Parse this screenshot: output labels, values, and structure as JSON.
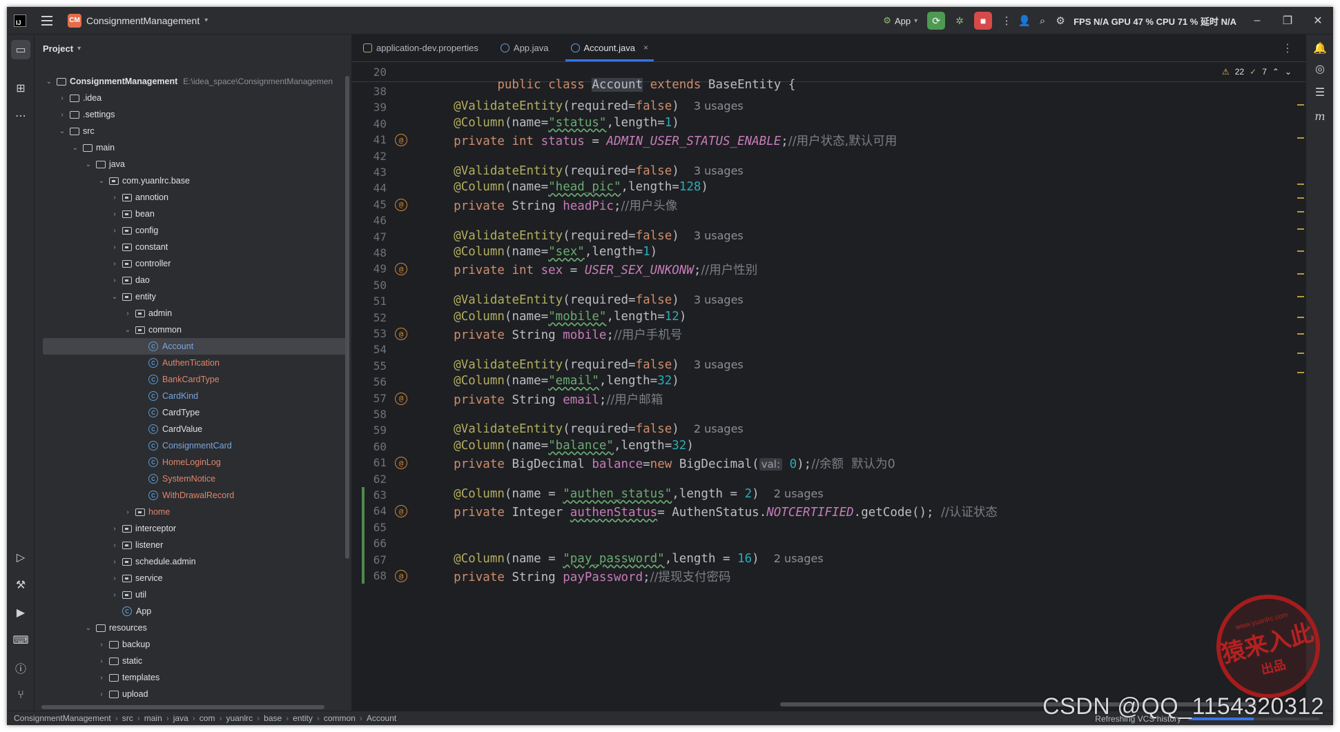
{
  "titlebar": {
    "project_badge": "CM",
    "project_name": "ConsignmentManagement",
    "run_config": "App",
    "stats_fps": "FPS",
    "stats_na1": "N/A",
    "stats_gpu": "GPU",
    "stats_gpu_val": "47 %",
    "stats_cpu": "CPU",
    "stats_cpu_val": "71 %",
    "stats_latency": "延时",
    "stats_na2": "N/A"
  },
  "project_panel": {
    "title": "Project",
    "root_name": "ConsignmentManagement",
    "root_path": "E:\\idea_space\\ConsignmentManagemen",
    "tree": [
      {
        "label": ".idea",
        "depth": 1,
        "type": "folder",
        "expanded": false
      },
      {
        "label": ".settings",
        "depth": 1,
        "type": "folder",
        "expanded": false
      },
      {
        "label": "src",
        "depth": 1,
        "type": "folder",
        "expanded": true
      },
      {
        "label": "main",
        "depth": 2,
        "type": "folder",
        "expanded": true
      },
      {
        "label": "java",
        "depth": 3,
        "type": "folder",
        "expanded": true
      },
      {
        "label": "com.yuanlrc.base",
        "depth": 4,
        "type": "pkg",
        "expanded": true
      },
      {
        "label": "annotion",
        "depth": 5,
        "type": "pkg",
        "expanded": false
      },
      {
        "label": "bean",
        "depth": 5,
        "type": "pkg",
        "expanded": false
      },
      {
        "label": "config",
        "depth": 5,
        "type": "pkg",
        "expanded": false
      },
      {
        "label": "constant",
        "depth": 5,
        "type": "pkg",
        "expanded": false
      },
      {
        "label": "controller",
        "depth": 5,
        "type": "pkg",
        "expanded": false
      },
      {
        "label": "dao",
        "depth": 5,
        "type": "pkg",
        "expanded": false
      },
      {
        "label": "entity",
        "depth": 5,
        "type": "pkg",
        "expanded": true
      },
      {
        "label": "admin",
        "depth": 6,
        "type": "pkg",
        "expanded": false
      },
      {
        "label": "common",
        "depth": 6,
        "type": "pkg",
        "expanded": true
      },
      {
        "label": "Account",
        "depth": 7,
        "type": "class",
        "color": "class",
        "selected": true
      },
      {
        "label": "AuthenTication",
        "depth": 7,
        "type": "class",
        "color": "red"
      },
      {
        "label": "BankCardType",
        "depth": 7,
        "type": "class",
        "color": "red"
      },
      {
        "label": "CardKind",
        "depth": 7,
        "type": "class",
        "color": "class"
      },
      {
        "label": "CardType",
        "depth": 7,
        "type": "class",
        "color": "plain"
      },
      {
        "label": "CardValue",
        "depth": 7,
        "type": "class",
        "color": "plain"
      },
      {
        "label": "ConsignmentCard",
        "depth": 7,
        "type": "class",
        "color": "class"
      },
      {
        "label": "HomeLoginLog",
        "depth": 7,
        "type": "class",
        "color": "red"
      },
      {
        "label": "SystemNotice",
        "depth": 7,
        "type": "class",
        "color": "red"
      },
      {
        "label": "WithDrawalRecord",
        "depth": 7,
        "type": "class",
        "color": "red"
      },
      {
        "label": "home",
        "depth": 6,
        "type": "pkg",
        "expanded": false,
        "color": "red"
      },
      {
        "label": "interceptor",
        "depth": 5,
        "type": "pkg",
        "expanded": false
      },
      {
        "label": "listener",
        "depth": 5,
        "type": "pkg",
        "expanded": false
      },
      {
        "label": "schedule.admin",
        "depth": 5,
        "type": "pkg",
        "expanded": false
      },
      {
        "label": "service",
        "depth": 5,
        "type": "pkg",
        "expanded": false
      },
      {
        "label": "util",
        "depth": 5,
        "type": "pkg",
        "expanded": false
      },
      {
        "label": "App",
        "depth": 5,
        "type": "app",
        "color": "plain"
      },
      {
        "label": "resources",
        "depth": 3,
        "type": "folder",
        "expanded": true
      },
      {
        "label": "backup",
        "depth": 4,
        "type": "folder",
        "expanded": false
      },
      {
        "label": "static",
        "depth": 4,
        "type": "folder",
        "expanded": false
      },
      {
        "label": "templates",
        "depth": 4,
        "type": "folder",
        "expanded": false
      },
      {
        "label": "upload",
        "depth": 4,
        "type": "folder",
        "expanded": false
      }
    ]
  },
  "tabs": [
    {
      "label": "application-dev.properties",
      "active": false,
      "icon": "properties-file-icon"
    },
    {
      "label": "App.java",
      "active": false,
      "icon": "java-app-icon"
    },
    {
      "label": "Account.java",
      "active": true,
      "icon": "java-class-icon",
      "close": "×"
    }
  ],
  "inspections": {
    "warnings": "22",
    "checks": "7"
  },
  "editor": {
    "sticky": {
      "num": "20",
      "text": "public class Account extends BaseEntity {"
    },
    "lines": [
      {
        "n": "38"
      },
      {
        "n": "39",
        "a": "required=",
        "b": "false",
        "u": "3 usages"
      },
      {
        "n": "40",
        "col": "status",
        "len": "1"
      },
      {
        "n": "41",
        "type": "int",
        "field": "status",
        "init": "ADMIN_USER_STATUS_ENABLE",
        "cmt": "//用户状态,默认可用"
      },
      {
        "n": "42"
      },
      {
        "n": "43",
        "u": "3 usages"
      },
      {
        "n": "44",
        "col": "head_pic",
        "len": "128"
      },
      {
        "n": "45",
        "type": "String",
        "field": "headPic",
        "cmt": "//用户头像"
      },
      {
        "n": "46"
      },
      {
        "n": "47",
        "u": "3 usages"
      },
      {
        "n": "48",
        "col": "sex",
        "len": "1"
      },
      {
        "n": "49",
        "type": "int",
        "field": "sex",
        "init": "USER_SEX_UNKONW",
        "cmt": "//用户性别"
      },
      {
        "n": "50"
      },
      {
        "n": "51",
        "u": "3 usages"
      },
      {
        "n": "52",
        "col": "mobile",
        "len": "12"
      },
      {
        "n": "53",
        "type": "String",
        "field": "mobile",
        "cmt": "//用户手机号"
      },
      {
        "n": "54"
      },
      {
        "n": "55",
        "u": "3 usages"
      },
      {
        "n": "56",
        "col": "email",
        "len": "32"
      },
      {
        "n": "57",
        "type": "String",
        "field": "email",
        "cmt": "//用户邮箱"
      },
      {
        "n": "58"
      },
      {
        "n": "59",
        "u": "2 usages"
      },
      {
        "n": "60",
        "col": "balance",
        "len": "32"
      },
      {
        "n": "61",
        "hint": "val:",
        "cmt": "//余额  默认为0"
      },
      {
        "n": "62"
      },
      {
        "n": "63",
        "col": "authen_status",
        "len": "2",
        "u": "2 usages"
      },
      {
        "n": "64",
        "cmt": "//认证状态"
      },
      {
        "n": "65"
      },
      {
        "n": "66"
      },
      {
        "n": "67",
        "col": "pay_password",
        "len": "16",
        "u": "2 usages"
      },
      {
        "n": "68",
        "cmt": "//提现支付密码"
      }
    ]
  },
  "statusbar": {
    "crumbs": [
      "ConsignmentManagement",
      "src",
      "main",
      "java",
      "com",
      "yuanlrc",
      "base",
      "entity",
      "common",
      "Account"
    ],
    "task": "Refreshing VCS history",
    "progress": 0.5
  },
  "watermark": {
    "csdn": "CSDN @QQ_1154320312",
    "seal_top": "www.yuanlrc.com",
    "seal_main": "猿来入此",
    "seal_bottom": "出品"
  },
  "colors": {
    "accent": "#3574f0",
    "keyword": "#cf8e6d",
    "annotation": "#b3ae60",
    "string": "#6aab73",
    "number": "#2aacb8",
    "constant": "#c77dbb",
    "comment": "#7a7e85"
  }
}
